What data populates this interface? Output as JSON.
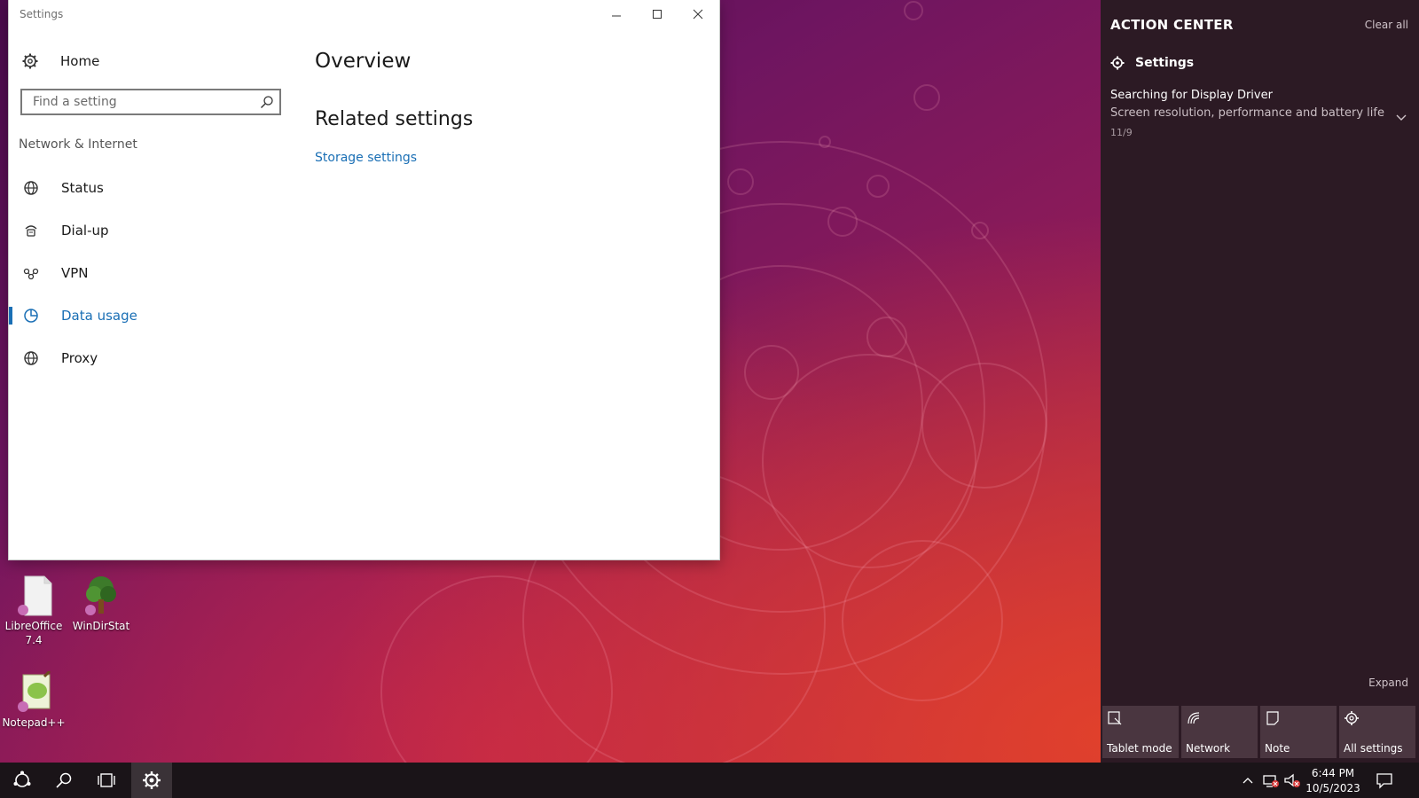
{
  "settings_window": {
    "title": "Settings",
    "home_label": "Home",
    "search": {
      "placeholder": "Find a setting"
    },
    "section_title": "Network & Internet",
    "nav_items": [
      {
        "label": "Status",
        "icon": "globe-status-icon"
      },
      {
        "label": "Dial-up",
        "icon": "dialup-icon"
      },
      {
        "label": "VPN",
        "icon": "vpn-icon"
      },
      {
        "label": "Data usage",
        "icon": "data-usage-icon",
        "selected": true
      },
      {
        "label": "Proxy",
        "icon": "globe-icon"
      }
    ],
    "main": {
      "heading": "Overview",
      "related_heading": "Related settings",
      "related_link": "Storage settings"
    }
  },
  "desktop_icons": [
    {
      "label": "LibreOffice 7.4",
      "icon": "libreoffice-icon"
    },
    {
      "label": "WinDirStat",
      "icon": "windirstat-icon"
    },
    {
      "label": "Notepad++",
      "icon": "notepadpp-icon"
    }
  ],
  "action_center": {
    "title": "ACTION CENTER",
    "clear_all": "Clear all",
    "notification": {
      "app": "Settings",
      "title": "Searching for Display Driver",
      "body": "Screen resolution, performance and battery life r",
      "time": "11/9"
    },
    "expand": "Expand",
    "quick_actions": [
      {
        "label": "Tablet mode",
        "icon": "tablet-mode-icon"
      },
      {
        "label": "Network",
        "icon": "network-icon"
      },
      {
        "label": "Note",
        "icon": "note-icon"
      },
      {
        "label": "All settings",
        "icon": "gear-icon"
      }
    ]
  },
  "taskbar": {
    "time": "6:44 PM",
    "date": "10/5/2023"
  },
  "colors": {
    "accent": "#1a6fb5",
    "action_center_bg": "#2c1a24",
    "taskbar_bg": "#1a1418"
  }
}
